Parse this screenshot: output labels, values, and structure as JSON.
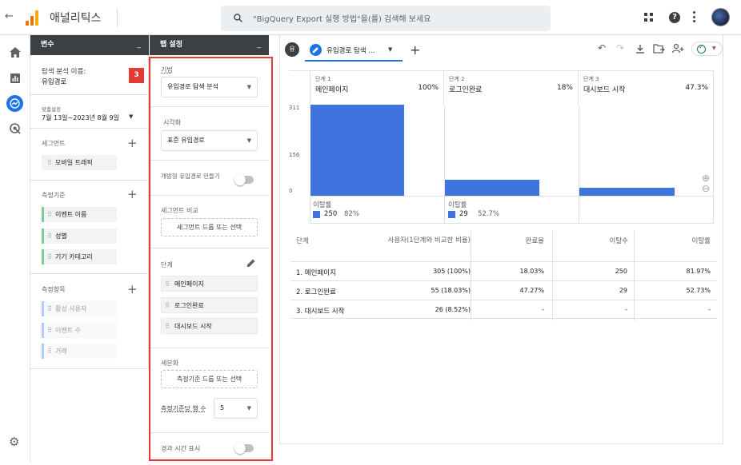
{
  "app": {
    "title": "애널리틱스"
  },
  "search": {
    "placeholder": "\"BigQuery Export 실행 방법\"을(를) 검색해 보세요"
  },
  "variables_panel": {
    "header": "변수",
    "minimize": "_",
    "exploration_name_label": "탐색 분석 이름:",
    "exploration_name": "유입경로",
    "callout_badge": "3",
    "date_label": "맞춤설정",
    "date_range": "7월 13일~2023년 8월 9일",
    "segments_label": "세그먼트",
    "segments": [
      "모바일 트래픽"
    ],
    "dimensions_label": "측정기준",
    "dimensions": [
      "이벤트 이름",
      "성별",
      "기기 카테고리"
    ],
    "metrics_label": "측정항목",
    "metrics": [
      "활성 사용자",
      "이벤트 수",
      "거래"
    ]
  },
  "tab_settings": {
    "header": "탭 설정",
    "minimize": "_",
    "technique_label": "기법",
    "technique_value": "유입경로 탐색 분석",
    "visualization_label": "시각화",
    "visualization_value": "표준 유입경로",
    "open_funnel_label": "개방형 유입경로 만들기",
    "segment_compare_label": "세그먼트 비교",
    "segment_drop": "세그먼트 드롭 또는 선택",
    "steps_label": "단계",
    "steps": [
      "메인페이지",
      "로그인완료",
      "대시보드 시작"
    ],
    "breakdown_label": "세분화",
    "dimension_drop": "측정기준 드롭 또는 선택",
    "rows_per_dim_label": "측정기준당 행 수",
    "rows_per_dim_value": "5",
    "elapsed_time_label": "경과 시간 표시"
  },
  "tabs": {
    "avatar_letter": "유",
    "active_tab": "유입경로 탐색 ...",
    "add": "+"
  },
  "funnel": {
    "steps": [
      {
        "step": "단계 1",
        "name": "메인페이지",
        "pct": "100%",
        "users": 311
      },
      {
        "step": "단계 2",
        "name": "로그인완료",
        "pct": "18%",
        "users": 55
      },
      {
        "step": "단계 3",
        "name": "대시보드 시작",
        "pct": "47.3%",
        "users": 26
      }
    ],
    "y_ticks": [
      "311",
      "156",
      "0"
    ],
    "ymax": 311,
    "abandon_label": "이탈률",
    "abandon": [
      {
        "count": "250",
        "pct": "82%"
      },
      {
        "count": "29",
        "pct": "52.7%"
      }
    ]
  },
  "table": {
    "headers": [
      "단계",
      "사용자(1단계와 비교한 비율)",
      "완료율",
      "이탈수",
      "이탈률"
    ],
    "rows": [
      [
        "1. 메인페이지",
        "305 (100%)",
        "18.03%",
        "250",
        "81.97%"
      ],
      [
        "2. 로그인완료",
        "55 (18.03%)",
        "47.27%",
        "29",
        "52.73%"
      ],
      [
        "3. 대시보드 시작",
        "26 (8.52%)",
        "-",
        "-",
        "-"
      ]
    ]
  },
  "colors": {
    "accent": "#3f73e0",
    "callout": "#e53935",
    "logo": [
      "#f9ab00",
      "#e37400"
    ]
  }
}
